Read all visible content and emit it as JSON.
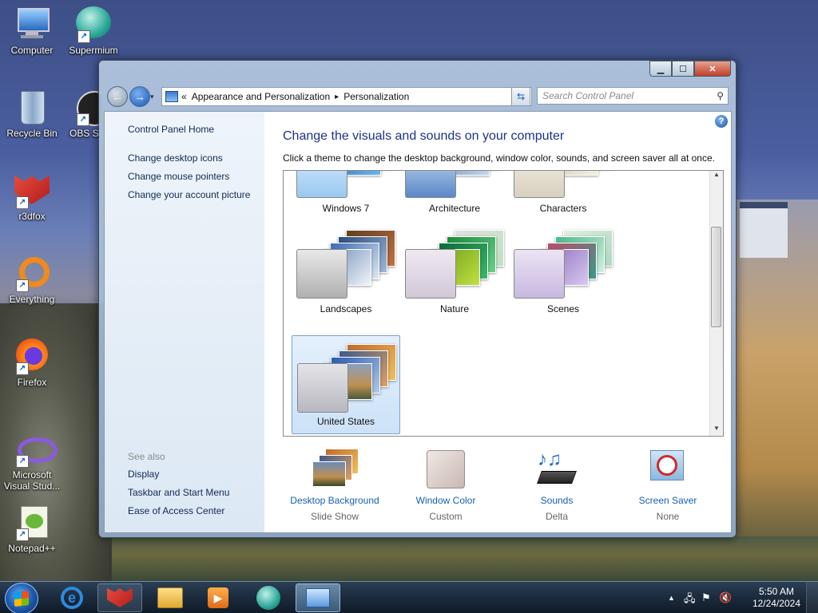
{
  "desktop": {
    "icons": [
      {
        "label": "Computer",
        "icon": "computer-icon"
      },
      {
        "label": "Supermium",
        "icon": "supermium-icon"
      },
      {
        "label": "Recycle Bin",
        "icon": "recycle-bin-icon"
      },
      {
        "label": "OBS St",
        "icon": "obs-icon"
      },
      {
        "label": "r3dfox",
        "icon": "r3dfox-icon"
      },
      {
        "label": "Everything",
        "icon": "everything-icon"
      },
      {
        "label": "Firefox",
        "icon": "firefox-icon"
      },
      {
        "label": "Microsoft Visual Stud...",
        "icon": "visual-studio-icon"
      },
      {
        "label": "Notepad++",
        "icon": "notepadpp-icon"
      }
    ]
  },
  "window": {
    "address": {
      "prefix": "«",
      "crumbs": [
        "Appearance and Personalization",
        "Personalization"
      ],
      "separator": "▸"
    },
    "search_placeholder": "Search Control Panel",
    "left_pane": {
      "home": "Control Panel Home",
      "tasks": [
        "Change desktop icons",
        "Change mouse pointers",
        "Change your account picture"
      ],
      "see_also_label": "See also",
      "see_also": [
        "Display",
        "Taskbar and Start Menu",
        "Ease of Access Center"
      ]
    },
    "title": "Change the visuals and sounds on your computer",
    "description": "Click a theme to change the desktop background, window color, sounds, and screen saver all at once.",
    "themes": [
      {
        "label": "Windows 7",
        "selected": false
      },
      {
        "label": "Architecture",
        "selected": false
      },
      {
        "label": "Characters",
        "selected": false
      },
      {
        "label": "Landscapes",
        "selected": false
      },
      {
        "label": "Nature",
        "selected": false
      },
      {
        "label": "Scenes",
        "selected": false
      },
      {
        "label": "United States",
        "selected": true
      }
    ],
    "bottom": [
      {
        "link": "Desktop Background",
        "sub": "Slide Show",
        "icon": "desktop-background-icon"
      },
      {
        "link": "Window Color",
        "sub": "Custom",
        "icon": "window-color-icon"
      },
      {
        "link": "Sounds",
        "sub": "Delta",
        "icon": "sounds-icon"
      },
      {
        "link": "Screen Saver",
        "sub": "None",
        "icon": "screen-saver-icon"
      }
    ]
  },
  "taskbar": {
    "time": "5:50 AM",
    "date": "12/24/2024"
  }
}
